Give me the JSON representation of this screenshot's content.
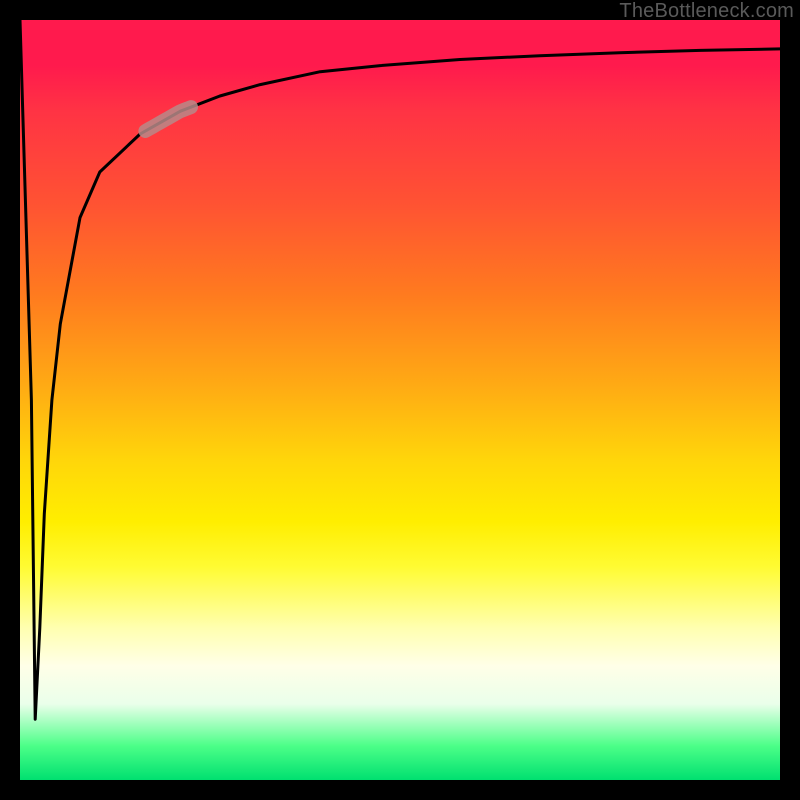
{
  "credit": "TheBottleneck.com",
  "colors": {
    "frame": "#000000",
    "curve": "#000000",
    "highlight": "#b78a88",
    "gradient_top": "#ff1a4d",
    "gradient_bottom": "#00e070"
  },
  "chart_data": {
    "type": "line",
    "title": "",
    "xlabel": "",
    "ylabel": "",
    "xlim": [
      0,
      100
    ],
    "ylim": [
      0,
      100
    ],
    "grid": false,
    "legend": false,
    "series": [
      {
        "name": "curve",
        "x": [
          0,
          1.5,
          2.0,
          2.6,
          3.2,
          4.2,
          5.3,
          7.9,
          10.5,
          15.8,
          21.1,
          26.3,
          31.6,
          39.5,
          47.4,
          57.9,
          68.4,
          78.9,
          89.5,
          100
        ],
        "values": [
          100,
          50,
          8,
          20,
          35,
          50,
          60,
          74,
          80,
          85,
          88,
          90,
          91.5,
          93.2,
          94.0,
          94.8,
          95.3,
          95.7,
          96.0,
          96.2
        ]
      }
    ],
    "annotations": [
      {
        "name": "highlight-segment",
        "x_range": [
          16.5,
          22.5
        ],
        "note": "thick pale band on curve"
      }
    ]
  }
}
